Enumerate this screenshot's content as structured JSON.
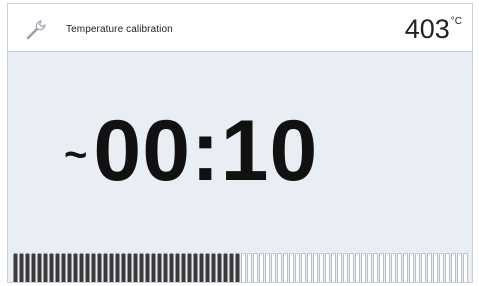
{
  "header": {
    "title": "Temperature calibration",
    "icon": "wrench-icon",
    "temperature": "403",
    "temperature_unit": "°C"
  },
  "timer": {
    "prefix": "~",
    "value": "00:10"
  },
  "progress": {
    "fraction": 0.5,
    "filled_color": "#3a3a3a",
    "empty_color": "#ffffff",
    "empty_stroke": "#aab3bd"
  },
  "colors": {
    "background": "#e9eef5",
    "header_bg": "#ffffff"
  }
}
